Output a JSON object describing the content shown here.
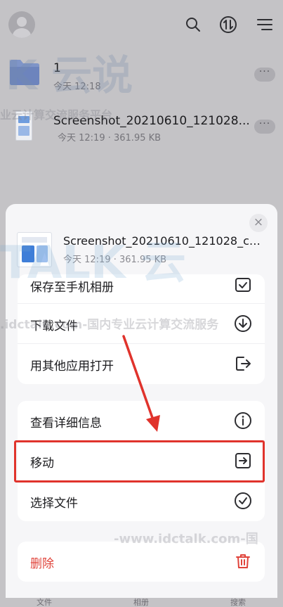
{
  "header": {
    "icons": [
      "avatar",
      "search-icon",
      "sort-icon",
      "menu-icon"
    ]
  },
  "files": [
    {
      "name": "1",
      "meta": "今天 12:18",
      "type": "folder",
      "more": "···"
    },
    {
      "name": "Screenshot_20210610_121028...",
      "meta": "今天 12:19 · 361.95 KB",
      "type": "image",
      "more": "···"
    }
  ],
  "sheet": {
    "close": "×",
    "file_name": "Screenshot_20210610_121028_com....",
    "file_meta": "今天 12:19 · 361.95 KB",
    "group1": [
      {
        "label": "保存至手机相册",
        "icon": "save-album-icon"
      },
      {
        "label": "下载文件",
        "icon": "download-icon"
      },
      {
        "label": "用其他应用打开",
        "icon": "open-external-icon"
      }
    ],
    "group2": [
      {
        "label": "查看详细信息",
        "icon": "info-icon"
      },
      {
        "label": "移动",
        "icon": "move-icon"
      },
      {
        "label": "选择文件",
        "icon": "check-circle-icon"
      }
    ],
    "group3": [
      {
        "label": "删除",
        "icon": "trash-icon"
      }
    ]
  },
  "watermark": {
    "brand": "K 云说",
    "line1": "业云计算交流服务平台",
    "line2": "TALK 云",
    "line3": ".idctalk.com-国内专业云计算交流服务",
    "line4": "-www.idctalk.com-国"
  },
  "bottom_tabs": [
    "文件",
    "相册",
    "搜索"
  ],
  "colors": {
    "accent_red": "#e0332c",
    "danger": "#e0433a",
    "sheet_bg": "#f6f6f8"
  }
}
